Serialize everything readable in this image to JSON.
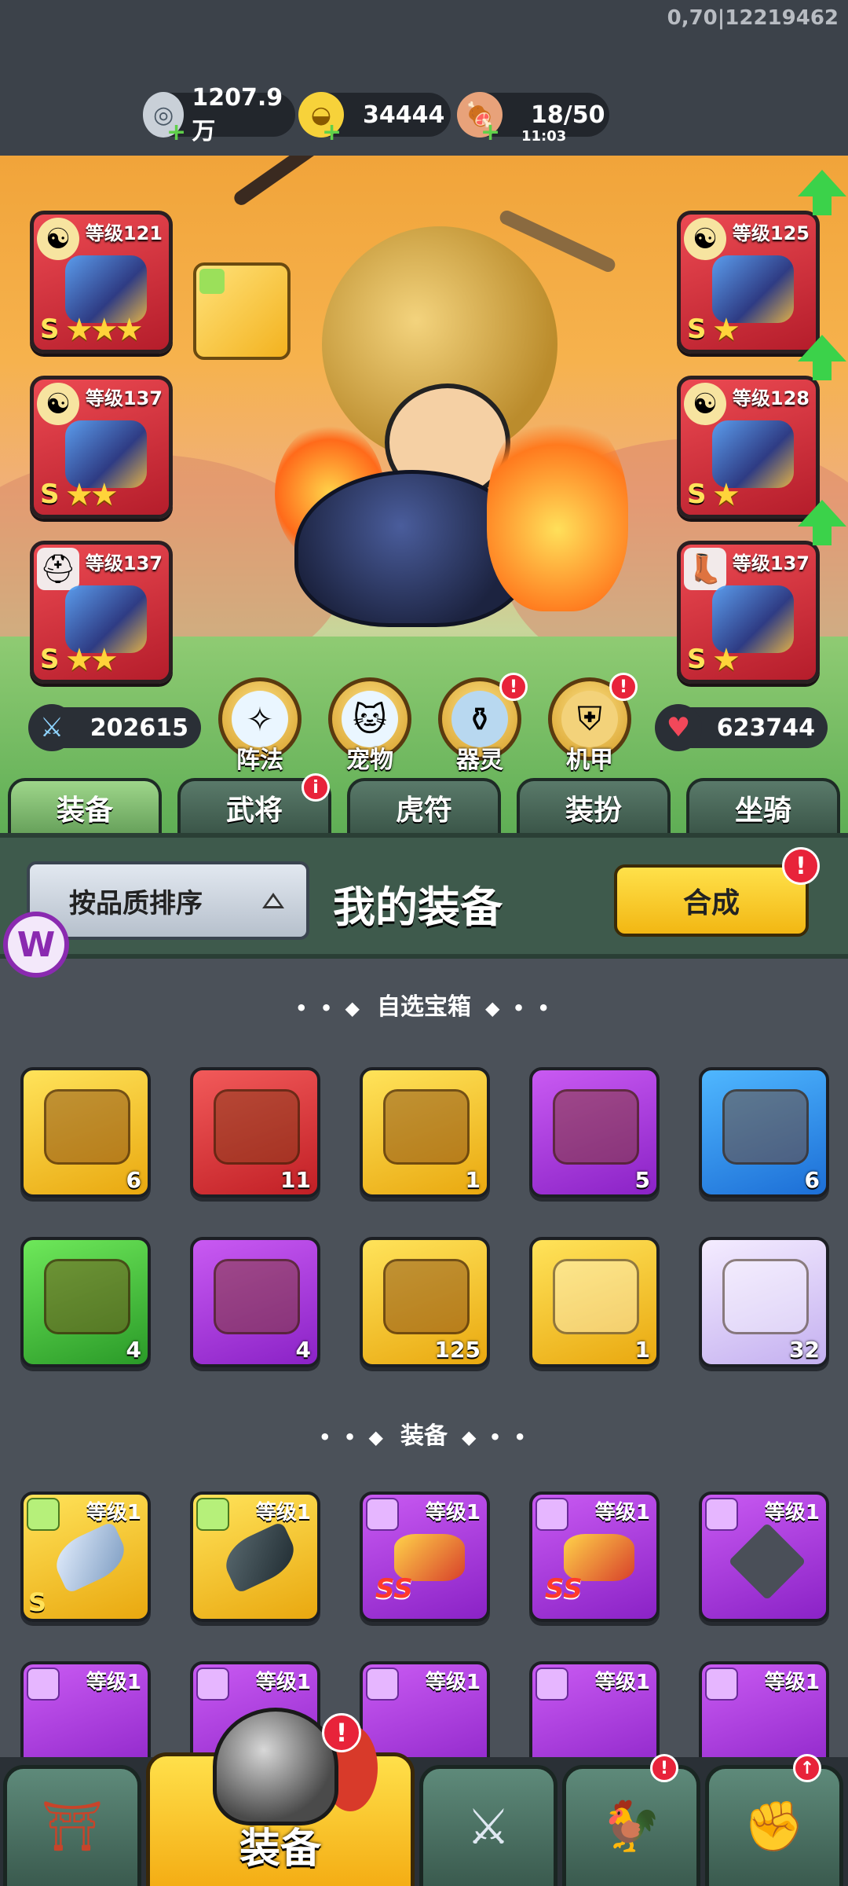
{
  "version": "0,70|12219462",
  "resources": [
    {
      "icon": "silver-coin-icon",
      "value": "1207.9万"
    },
    {
      "icon": "gold-ingot-icon",
      "value": "34444"
    },
    {
      "icon": "meat-icon",
      "value": "18/50",
      "timer": "11:03"
    }
  ],
  "equip_slots": {
    "left": [
      {
        "level": "等级121",
        "rank": "S",
        "stars": "★★★",
        "type_icon": "yin-yang-icon"
      },
      {
        "level": "等级137",
        "rank": "S",
        "stars": "★★",
        "type_icon": "yin-yang-icon"
      },
      {
        "level": "等级137",
        "rank": "S",
        "stars": "★★",
        "type_icon": "helmet-icon"
      }
    ],
    "right": [
      {
        "level": "等级125",
        "rank": "S",
        "stars": "★",
        "type_icon": "yin-yang-icon"
      },
      {
        "level": "等级128",
        "rank": "S",
        "stars": "★",
        "type_icon": "yin-yang-icon"
      },
      {
        "level": "等级137",
        "rank": "S",
        "stars": "★",
        "type_icon": "boot-icon"
      }
    ]
  },
  "stats": {
    "attack": "202615",
    "hp": "623744"
  },
  "feature_buttons": [
    {
      "label": "阵法",
      "icon": "formation-icon",
      "alert": false
    },
    {
      "label": "宠物",
      "icon": "cat-pet-icon",
      "alert": false
    },
    {
      "label": "器灵",
      "icon": "spirit-icon",
      "alert": true
    },
    {
      "label": "机甲",
      "icon": "mecha-icon",
      "alert": true
    }
  ],
  "tabs": [
    {
      "label": "装备",
      "active": true,
      "badge": false
    },
    {
      "label": "武将",
      "active": false,
      "badge": true
    },
    {
      "label": "虎符",
      "active": false,
      "badge": false
    },
    {
      "label": "装扮",
      "active": false,
      "badge": false
    },
    {
      "label": "坐骑",
      "active": false,
      "badge": false
    }
  ],
  "panel": {
    "sort_label": "按品质排序",
    "title": "我的装备",
    "merge_label": "合成",
    "alert": "!",
    "info": "i"
  },
  "section_chests": {
    "title": "自选宝箱",
    "items": [
      {
        "color": "gold",
        "count": "6"
      },
      {
        "color": "red",
        "count": "11"
      },
      {
        "color": "gold",
        "count": "1"
      },
      {
        "color": "purple",
        "count": "5"
      },
      {
        "color": "blue",
        "count": "6"
      },
      {
        "color": "green",
        "count": "4"
      },
      {
        "color": "purple",
        "count": "4"
      },
      {
        "color": "gold",
        "count": "125"
      },
      {
        "color": "gold",
        "count": "1"
      },
      {
        "color": "light",
        "count": "32"
      }
    ]
  },
  "section_equipment": {
    "title": "装备",
    "items": [
      {
        "color": "gold",
        "level": "等级1",
        "rank": "S"
      },
      {
        "color": "gold",
        "level": "等级1",
        "rank": ""
      },
      {
        "color": "purple",
        "level": "等级1",
        "rank": "SS"
      },
      {
        "color": "purple",
        "level": "等级1",
        "rank": "SS"
      },
      {
        "color": "purple",
        "level": "等级1",
        "rank": ""
      },
      {
        "color": "purple",
        "level": "等级1",
        "rank": ""
      },
      {
        "color": "purple",
        "level": "等级1",
        "rank": ""
      },
      {
        "color": "purple",
        "level": "等级1",
        "rank": ""
      },
      {
        "color": "purple",
        "level": "等级1",
        "rank": ""
      },
      {
        "color": "purple",
        "level": "等级1",
        "rank": ""
      }
    ]
  },
  "bottom_nav": {
    "main_label": "装备",
    "items": [
      {
        "icon": "gate-icon"
      },
      {
        "icon": "equipment-helmet-icon"
      },
      {
        "icon": "sword-shield-icon"
      },
      {
        "icon": "rooster-icon",
        "alert": true
      },
      {
        "icon": "fist-upgrade-icon",
        "upgrade": true
      }
    ]
  }
}
